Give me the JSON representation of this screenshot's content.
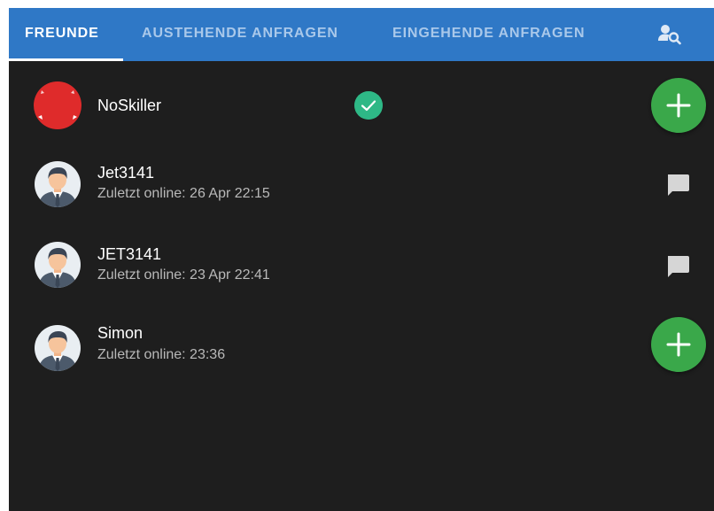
{
  "tabs": [
    {
      "label": "FREUNDE",
      "active": true
    },
    {
      "label": "AUSTEHENDE ANFRAGEN",
      "active": false
    },
    {
      "label": "EINGEHENDE ANFRAGEN",
      "active": false
    }
  ],
  "search_icon": "person-search-icon",
  "colors": {
    "tabbar": "#2f78c6",
    "background": "#1e1e1e",
    "add_button": "#3aa84a",
    "verified_badge": "#2eb886",
    "red_avatar": "#df2b2b"
  },
  "friends": [
    {
      "name": "NoSkiller",
      "status": "",
      "avatar": "red-avatar",
      "verified": true,
      "action": "add"
    },
    {
      "name": "Jet3141",
      "status": "Zuletzt online: 26 Apr 22:15",
      "avatar": "default-user-avatar",
      "verified": false,
      "action": "chat"
    },
    {
      "name": "JET3141",
      "status": "Zuletzt online: 23 Apr 22:41",
      "avatar": "default-user-avatar",
      "verified": false,
      "action": "chat"
    },
    {
      "name": "Simon",
      "status": "Zuletzt online: 23:36",
      "avatar": "default-user-avatar",
      "verified": false,
      "action": "add"
    }
  ]
}
